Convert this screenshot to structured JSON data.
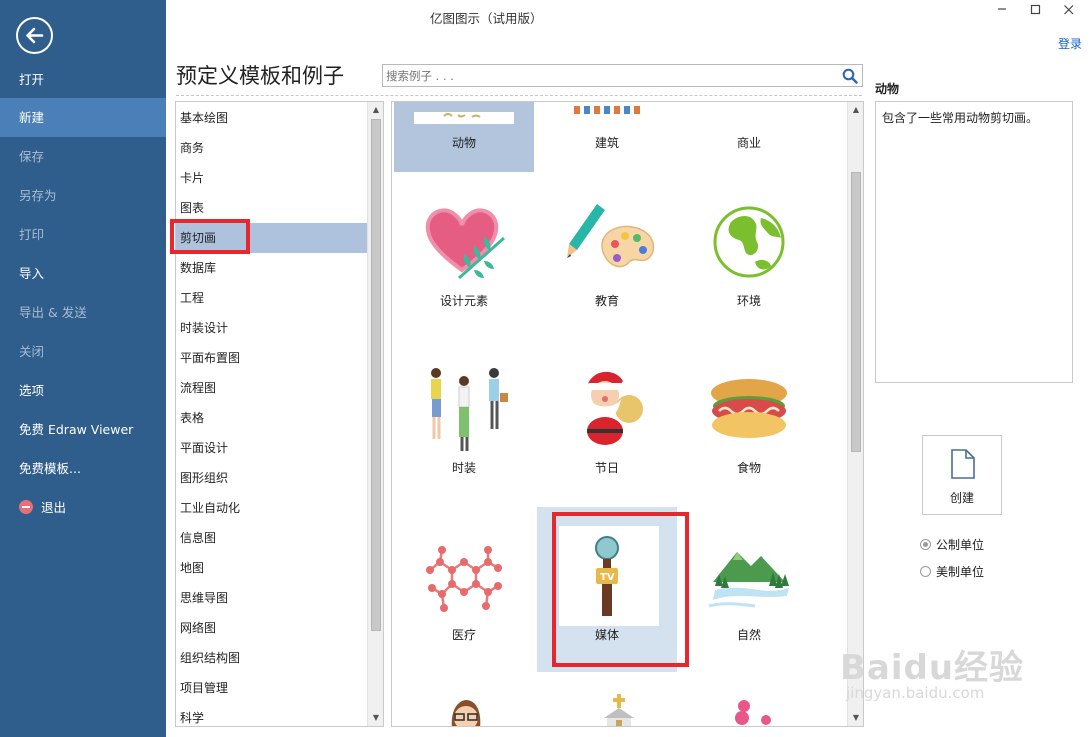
{
  "window": {
    "title": "亿图图示（试用版）",
    "login": "登录"
  },
  "nav": {
    "items": [
      {
        "label": "打开",
        "state": "normal"
      },
      {
        "label": "新建",
        "state": "active"
      },
      {
        "label": "保存",
        "state": "disabled"
      },
      {
        "label": "另存为",
        "state": "disabled"
      },
      {
        "label": "打印",
        "state": "disabled"
      },
      {
        "label": "导入",
        "state": "normal"
      },
      {
        "label": "导出 & 发送",
        "state": "disabled"
      },
      {
        "label": "关闭",
        "state": "disabled"
      },
      {
        "label": "选项",
        "state": "normal"
      },
      {
        "label": "免费 Edraw Viewer",
        "state": "normal"
      },
      {
        "label": "免费模板...",
        "state": "normal"
      },
      {
        "label": "退出",
        "state": "normal"
      }
    ]
  },
  "main": {
    "heading": "预定义模板和例子",
    "search_placeholder": "搜索例子 . . ."
  },
  "categories": {
    "items": [
      "基本绘图",
      "商务",
      "卡片",
      "图表",
      "剪切画",
      "数据库",
      "工程",
      "时装设计",
      "平面布置图",
      "流程图",
      "表格",
      "平面设计",
      "图形组织",
      "工业自动化",
      "信息图",
      "地图",
      "思维导图",
      "网络图",
      "组织结构图",
      "项目管理",
      "科学"
    ],
    "selected": "剪切画"
  },
  "templates": {
    "items": [
      "动物",
      "建筑",
      "商业",
      "设计元素",
      "教育",
      "环境",
      "时装",
      "节日",
      "食物",
      "医疗",
      "媒体",
      "自然"
    ],
    "selected": "动物",
    "highlighted": "媒体"
  },
  "detail": {
    "title": "动物",
    "description": "包含了一些常用动物剪切画。"
  },
  "actions": {
    "create": "创建"
  },
  "units": {
    "metric": "公制单位",
    "us": "美制单位",
    "selected": "metric"
  },
  "watermark": {
    "brand": "Baidu经验",
    "url": "jingyan.baidu.com"
  },
  "colors": {
    "nav_bg": "#2f5d8c",
    "nav_active": "#4a7fb8",
    "selection": "#aec1dd",
    "annotation": "#e8262d"
  }
}
